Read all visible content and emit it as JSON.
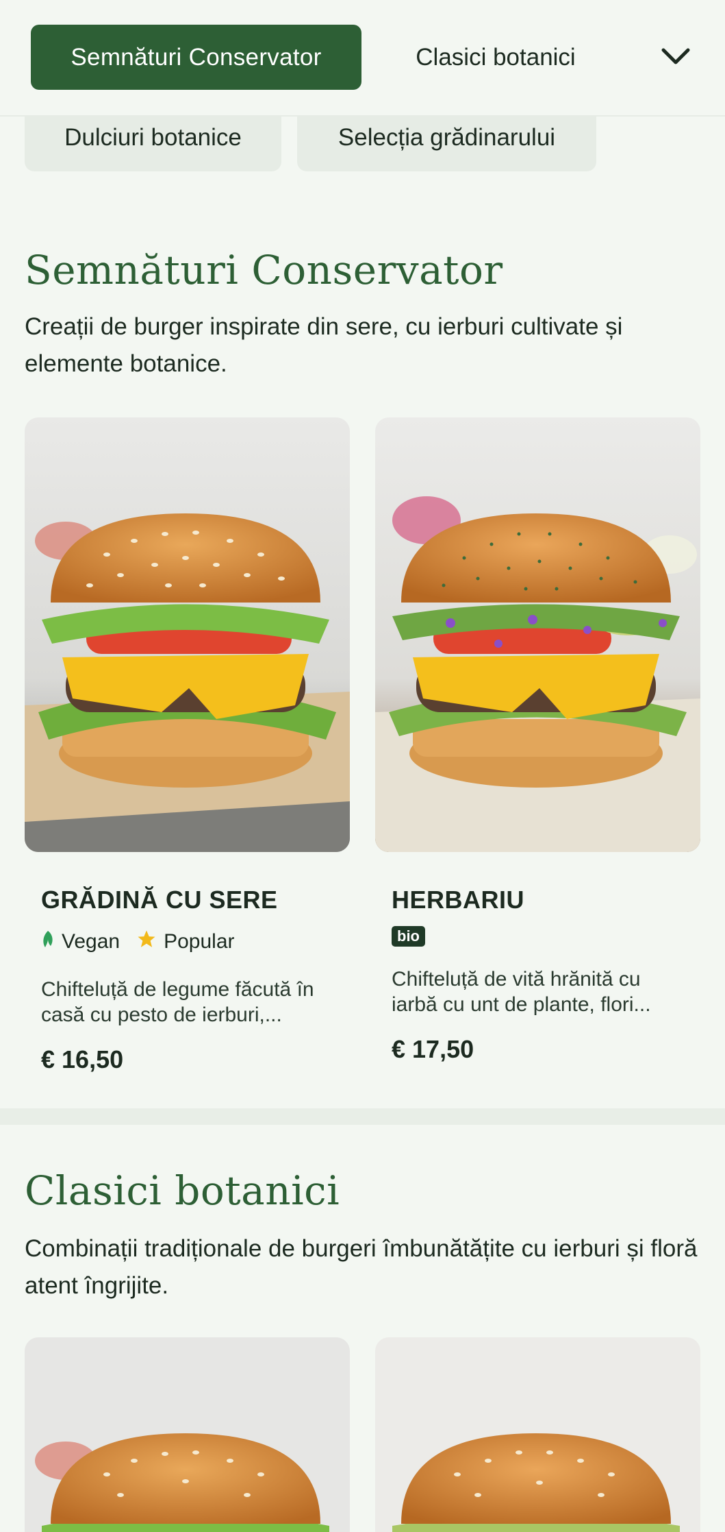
{
  "nav": {
    "tabs": [
      {
        "label": "Semnături Conservator",
        "active": true
      },
      {
        "label": "Clasici botanici",
        "active": false
      },
      {
        "label": "Dulciuri botanice"
      },
      {
        "label": "Selecția grădinarului"
      }
    ],
    "more_icon": "chevron-down-icon"
  },
  "sections": [
    {
      "title": "Semnături Conservator",
      "description": "Creații de burger inspirate din sere, cu ierburi cultivate și elemente botanice.",
      "items": [
        {
          "name": "GRĂDINĂ CU SERE",
          "tags": [
            {
              "icon": "leaf-icon",
              "label": "Vegan",
              "color": "#2fa05a"
            },
            {
              "icon": "star-icon",
              "label": "Popular",
              "color": "#f2b91a"
            }
          ],
          "description": "Chifteluță de legume făcută în casă cu pesto de ierburi,...",
          "price": "€ 16,50"
        },
        {
          "name": "HERBARIU",
          "badge": "bio",
          "description": "Chifteluță de vită hrănită cu iarbă cu unt de plante, flori...",
          "price": "€ 17,50"
        }
      ]
    },
    {
      "title": "Clasici botanici",
      "description": "Combinații tradiționale de burgeri îmbunătățite cu ierburi și floră atent îngrijite."
    }
  ],
  "colors": {
    "brand_green": "#2d5f35",
    "background": "#f3f7f2",
    "chip_bg": "#e6ece5",
    "badge_bg": "#1f3a27"
  }
}
